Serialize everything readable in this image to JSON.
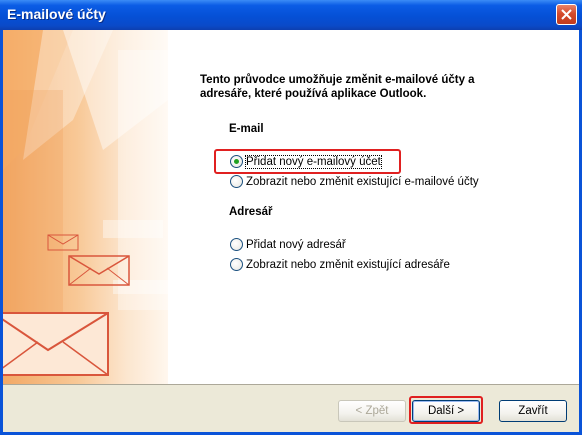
{
  "window": {
    "title": "E-mailové účty"
  },
  "main": {
    "intro_line1": "Tento průvodce umožňuje změnit e-mailové účty a",
    "intro_line2": "adresáře, které používá aplikace Outlook.",
    "email_section": {
      "heading": "E-mail",
      "options": [
        {
          "label": "Přidat nový e-mailový účet",
          "checked": true
        },
        {
          "label": "Zobrazit nebo změnit existující e-mailové účty",
          "checked": false
        }
      ]
    },
    "addressbook_section": {
      "heading": "Adresář",
      "options": [
        {
          "label": "Přidat nový adresář",
          "checked": false
        },
        {
          "label": "Zobrazit nebo změnit existující adresáře",
          "checked": false
        }
      ]
    }
  },
  "footer": {
    "back_label": "< Zpět",
    "next_label": "Další >",
    "close_label": "Zavřít"
  },
  "colors": {
    "titlebar": "#0550d6",
    "highlight": "#e02020",
    "radio_selected": "#21a121"
  }
}
